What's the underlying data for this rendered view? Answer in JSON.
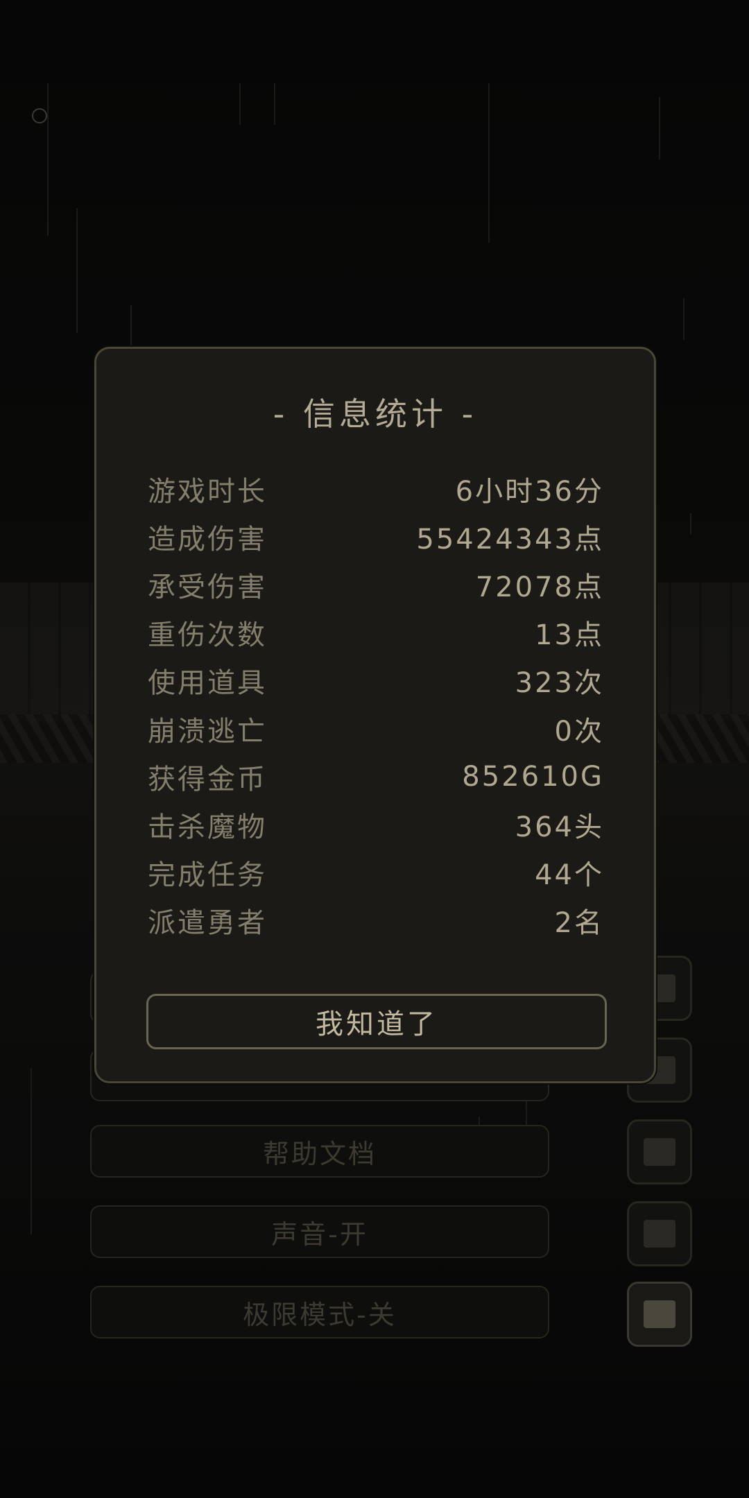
{
  "dialog": {
    "title": "- 信息统计 -",
    "stats": [
      {
        "label": "游戏时长",
        "value": "6小时36分"
      },
      {
        "label": "造成伤害",
        "value": "55424343点"
      },
      {
        "label": "承受伤害",
        "value": "72078点"
      },
      {
        "label": "重伤次数",
        "value": "13点"
      },
      {
        "label": "使用道具",
        "value": "323次"
      },
      {
        "label": "崩溃逃亡",
        "value": "0次"
      },
      {
        "label": "获得金币",
        "value": "852610G"
      },
      {
        "label": "击杀魔物",
        "value": "364头"
      },
      {
        "label": "完成任务",
        "value": "44个"
      },
      {
        "label": "派遣勇者",
        "value": "2名"
      }
    ],
    "confirm_label": "我知道了"
  },
  "menu": {
    "items": [
      {
        "label": "帮助文档"
      },
      {
        "label": "声音-开"
      },
      {
        "label": "极限模式-关"
      }
    ]
  },
  "side_icons": [
    "sword-icon",
    "notebook-icon",
    "map-scroll-icon",
    "document-icon",
    "computer-icon"
  ],
  "colors": {
    "dialog_bg": "#1b1a17",
    "dialog_border": "#4a4638",
    "label_text": "#847e6d",
    "value_text": "#b0a890"
  }
}
